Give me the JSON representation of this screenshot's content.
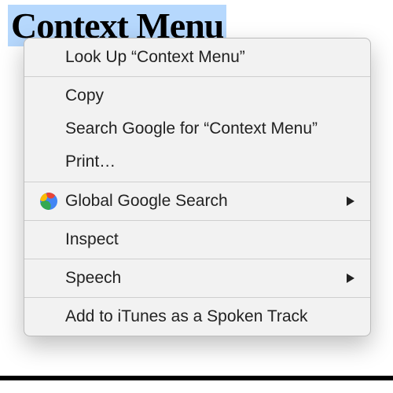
{
  "selection": {
    "text": "Context Menu"
  },
  "arrow": {
    "color": "#d9302c"
  },
  "menu": {
    "groups": [
      {
        "items": [
          {
            "label": "Look Up “Context Menu”",
            "name": "lookup",
            "submenu": false,
            "icon": null
          }
        ]
      },
      {
        "items": [
          {
            "label": "Copy",
            "name": "copy",
            "submenu": false,
            "icon": null
          },
          {
            "label": "Search Google for “Context Menu”",
            "name": "search-google",
            "submenu": false,
            "icon": null
          },
          {
            "label": "Print…",
            "name": "print",
            "submenu": false,
            "icon": null
          }
        ]
      },
      {
        "items": [
          {
            "label": "Global Google Search",
            "name": "global-google-search",
            "submenu": true,
            "icon": "globe-icon"
          }
        ]
      },
      {
        "items": [
          {
            "label": "Inspect",
            "name": "inspect",
            "submenu": false,
            "icon": null
          }
        ]
      },
      {
        "items": [
          {
            "label": "Speech",
            "name": "speech",
            "submenu": true,
            "icon": null
          }
        ]
      },
      {
        "items": [
          {
            "label": "Add to iTunes as a Spoken Track",
            "name": "add-to-itunes",
            "submenu": false,
            "icon": null
          }
        ]
      }
    ]
  }
}
